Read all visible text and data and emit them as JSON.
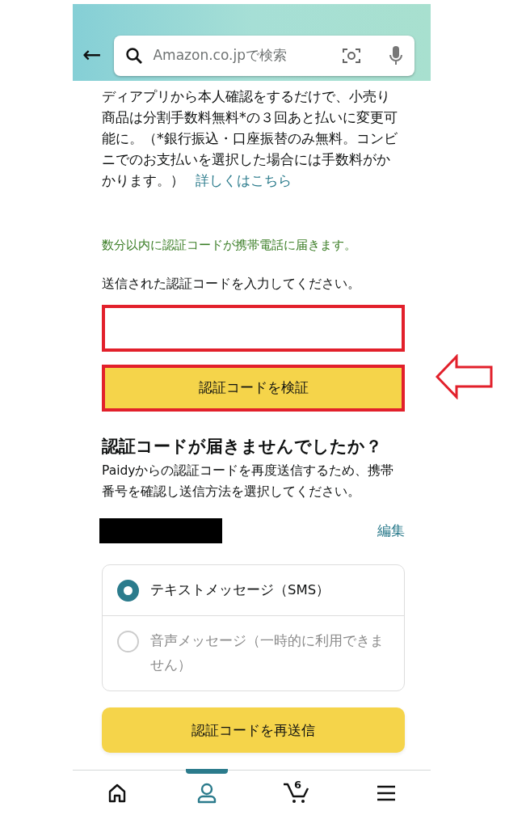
{
  "header": {
    "back": "←",
    "search_placeholder": "Amazon.co.jpで検索"
  },
  "notice": {
    "text": "ディアプリから本人確認をするだけで、小売り商品は分割手数料無料*の３回あと払いに変更可能に。（*銀行振込・口座振替のみ無料。コンビニでのお支払いを選択した場合には手数料がかかります。）",
    "link": "詳しくはこちら"
  },
  "sent_message": "数分以内に認証コードが携帯電話に届きます。",
  "code_prompt": "送信された認証コードを入力してください。",
  "verify_button": "認証コードを検証",
  "resend_section": {
    "title": "認証コードが届きませんでしたか？",
    "description": "Paidyからの認証コードを再度送信するため、携帯番号を確認し送信方法を選択してください。",
    "edit_link": "編集",
    "options": [
      {
        "label": "テキストメッセージ（SMS）",
        "selected": true,
        "disabled": false
      },
      {
        "label": "音声メッセージ（一時的に利用できません）",
        "selected": false,
        "disabled": true
      }
    ],
    "resend_button": "認証コードを再送信"
  },
  "bottom_nav": [
    {
      "kind": "home",
      "selected": false
    },
    {
      "kind": "account",
      "selected": true
    },
    {
      "kind": "cart",
      "selected": false,
      "count": "6"
    },
    {
      "kind": "menu",
      "selected": false
    }
  ]
}
